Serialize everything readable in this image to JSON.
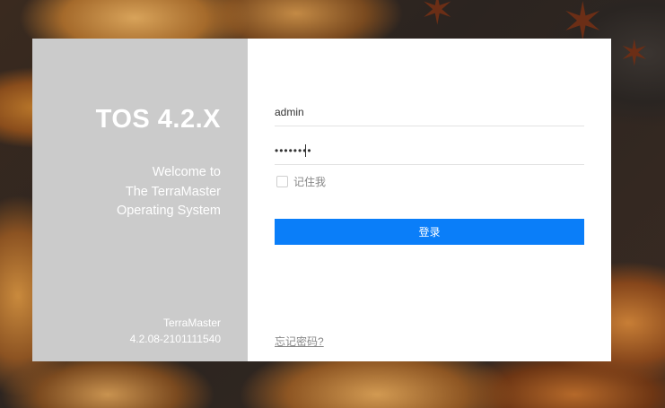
{
  "brand": {
    "title": "TOS 4.2.X",
    "welcome_lines": [
      "Welcome to",
      "The TerraMaster",
      "Operating System"
    ],
    "company": "TerraMaster",
    "version": "4.2.08-2101111540"
  },
  "login": {
    "username_value": "admin",
    "password_value": "••••••••",
    "remember_label": "记住我",
    "remember_checked": false,
    "submit_label": "登录",
    "forgot_label": "忘记密码?"
  },
  "colors": {
    "accent": "#0a7ef9",
    "left_panel": "#cbcbcb"
  }
}
